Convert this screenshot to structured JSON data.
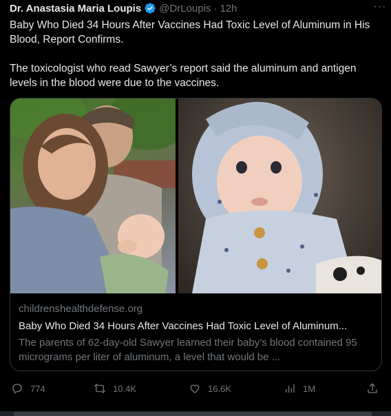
{
  "author": {
    "name": "Dr. Anastasia Maria Loupis",
    "handle": "@DrLoupis",
    "separator": "·",
    "time": "12h",
    "verified_color": "#1d9bf0"
  },
  "more_label": "···",
  "tweet": {
    "paragraph1": "Baby Who Died 34 Hours After Vaccines Had Toxic Level of Aluminum in His Blood, Report Confirms.",
    "paragraph2": "The toxicologist who read Sawyer’s report said the aluminum and antigen levels in the blood were due to the vaccines."
  },
  "card": {
    "domain": "childrenshealthdefense.org",
    "title": "Baby Who Died 34 Hours After Vaccines Had Toxic Level of Aluminum...",
    "description": "The parents of 62-day-old Sawyer learned their baby’s blood contained 95 micrograms per liter of aluminum, a level that would be ..."
  },
  "actions": {
    "replies": "774",
    "reposts": "10.4K",
    "likes": "16.6K",
    "views": "1M"
  },
  "colors": {
    "background": "#000000",
    "text": "#e7e9ea",
    "muted": "#71767b",
    "border": "#2f3336"
  }
}
